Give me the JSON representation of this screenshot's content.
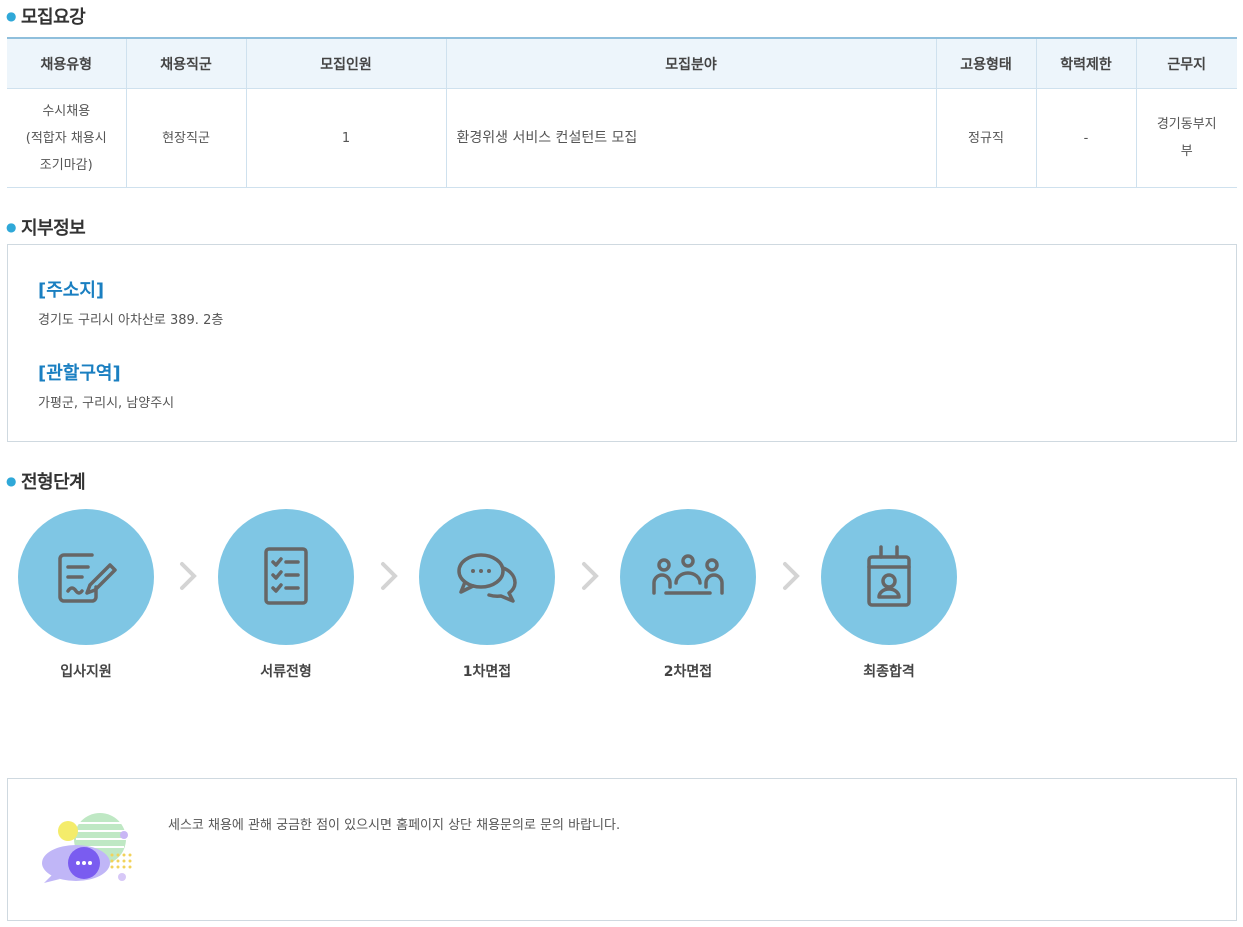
{
  "recruit": {
    "title": "모집요강",
    "headers": [
      "채용유형",
      "채용직군",
      "모집인원",
      "모집분야",
      "고용형태",
      "학력제한",
      "근무지"
    ],
    "row": {
      "type_line1": "수시채용",
      "type_line2": "(적합자 채용시",
      "type_line3": "조기마감)",
      "group": "현장직군",
      "count": "1",
      "field": "환경위생 서비스 컨설턴트 모집",
      "employment": "정규직",
      "education": "-",
      "location_line1": "경기동부지",
      "location_line2": "부"
    }
  },
  "branch": {
    "title": "지부정보",
    "address_heading": "[주소지]",
    "address": "경기도 구리시 아차산로 389. 2층",
    "region_heading": "[관할구역]",
    "region": "가평군, 구리시, 남양주시"
  },
  "process": {
    "title": "전형단계",
    "steps": [
      {
        "label": "입사지원",
        "icon": "application-form-icon"
      },
      {
        "label": "서류전형",
        "icon": "checklist-icon"
      },
      {
        "label": "1차면접",
        "icon": "chat-bubbles-icon"
      },
      {
        "label": "2차면접",
        "icon": "group-meeting-icon"
      },
      {
        "label": "최종합격",
        "icon": "id-badge-icon"
      }
    ]
  },
  "notice": {
    "text": "세스코 채용에 관해 궁금한 점이 있으시면 홈페이지 상단 채용문의로 문의 바랍니다."
  },
  "colors": {
    "accent": "#2fa8d8",
    "heading_blue": "#1a7fc1",
    "circle": "#7fc6e4",
    "header_bg": "#edf5fb"
  }
}
